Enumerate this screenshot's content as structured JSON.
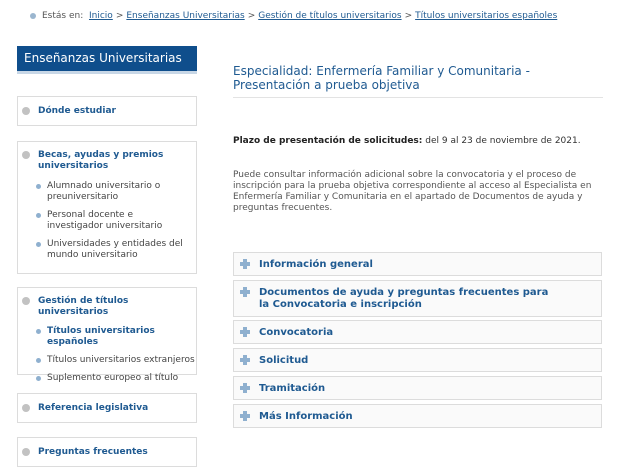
{
  "breadcrumb": {
    "prefix": "Estás en:",
    "items": [
      "Inicio",
      "Enseñanzas Universitarias",
      "Gestión de títulos universitarios",
      "Títulos universitarios españoles"
    ],
    "separator": ">"
  },
  "sidebar": {
    "title": "Enseñanzas Universitarias",
    "sections": [
      {
        "label": "Dónde estudiar",
        "subitems": []
      },
      {
        "label": "Becas, ayudas y premios universitarios",
        "subitems": [
          "Alumnado universitario o preuniversitario",
          "Personal docente e investigador universitario",
          "Universidades y entidades del mundo universitario"
        ]
      },
      {
        "label": "Gestión de títulos universitarios",
        "subitems": [
          "Títulos universitarios españoles",
          "Títulos universitarios extranjeros",
          "Suplemento europeo al título"
        ]
      },
      {
        "label": "Referencia legislativa",
        "subitems": []
      },
      {
        "label": "Preguntas frecuentes",
        "subitems": []
      }
    ]
  },
  "main": {
    "title": "Especialidad: Enfermería Familiar y Comunitaria - Presentación a prueba objetiva",
    "plazo_label": "Plazo de presentación de solicitudes:",
    "plazo_value": " del 9 al 23 de noviembre de 2021.",
    "info": "Puede consultar información adicional sobre la convocatoria y el proceso de inscripción para la prueba objetiva correspondiente al acceso al Especialista en Enfermería Familiar y Comunitaria en el apartado de Documentos de ayuda y preguntas frecuentes.",
    "accordion": [
      "Información general",
      "Documentos de ayuda y preguntas frecuentes para la Convocatoria e inscripción",
      "Convocatoria",
      "Solicitud",
      "Tramitación",
      "Más Información"
    ]
  },
  "colors": {
    "brand": "#0f4e8c",
    "link": "#1f5a91",
    "plus": "#8fb0cf"
  }
}
